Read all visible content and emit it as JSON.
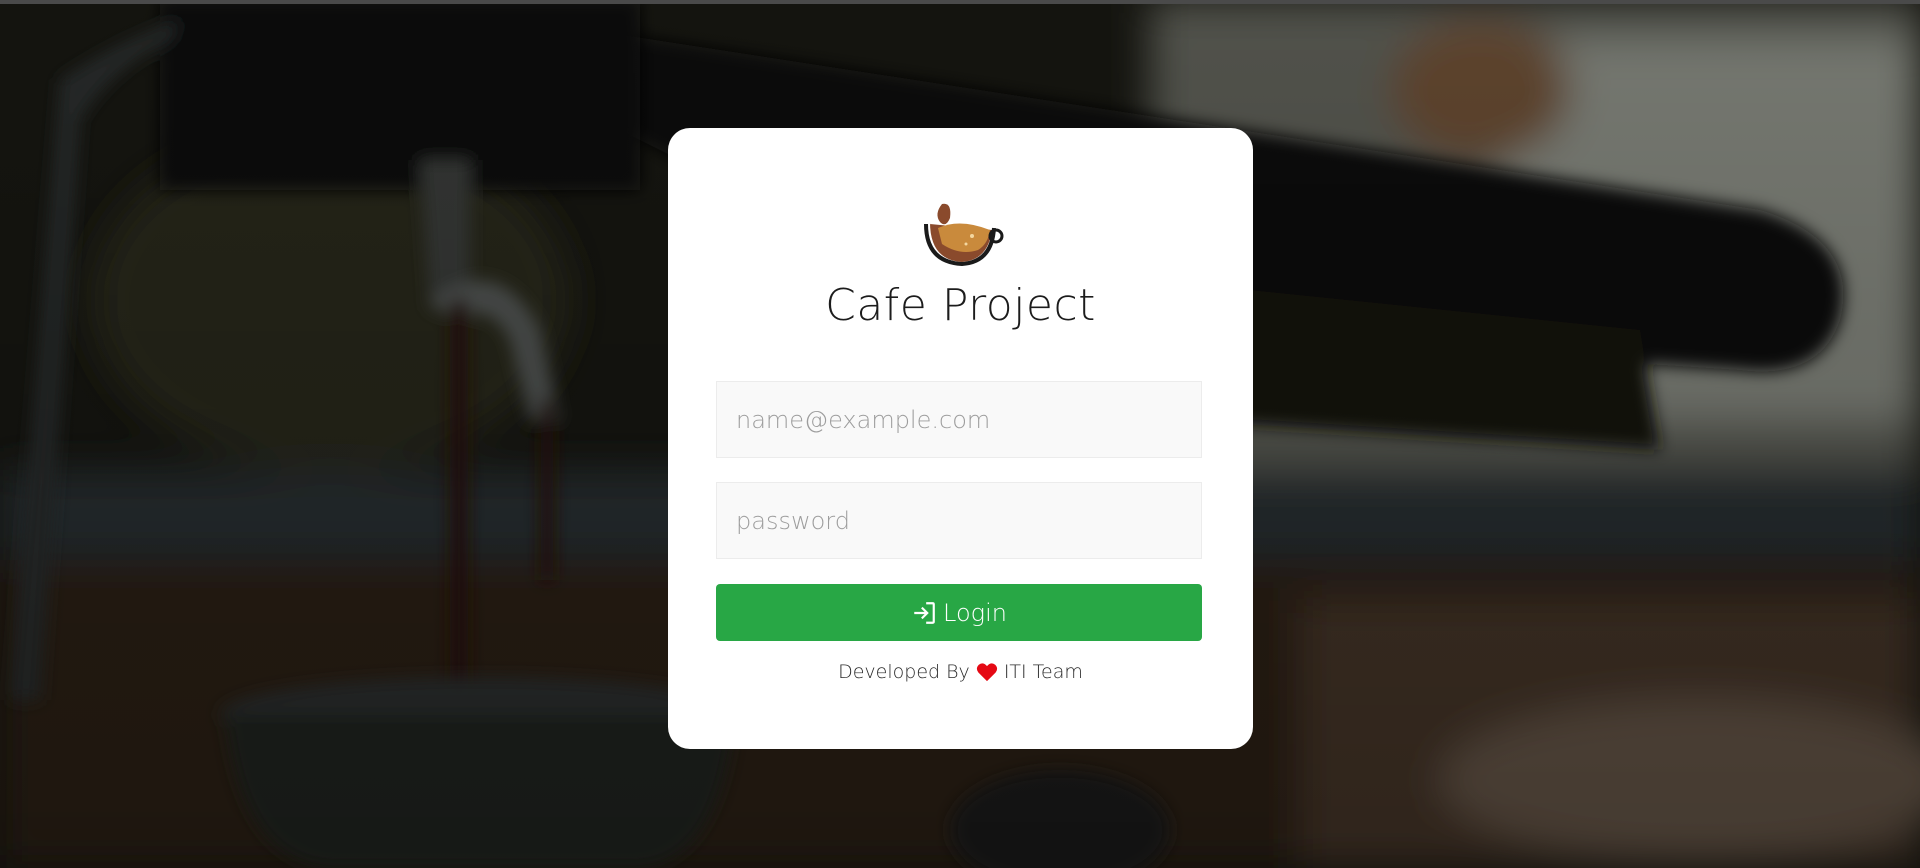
{
  "app": {
    "title": "Cafe Project"
  },
  "form": {
    "email_placeholder": "name@example.com",
    "email_value": "",
    "password_placeholder": "password",
    "password_value": "",
    "login_label": "Login"
  },
  "footer": {
    "prefix": "Developed By",
    "suffix": "ITI Team"
  },
  "icons": {
    "logo": "coffee-cup-icon",
    "login": "sign-in-icon",
    "heart": "heart-icon"
  },
  "colors": {
    "accent": "#28a745",
    "heart": "#e50914",
    "card": "#ffffff"
  }
}
